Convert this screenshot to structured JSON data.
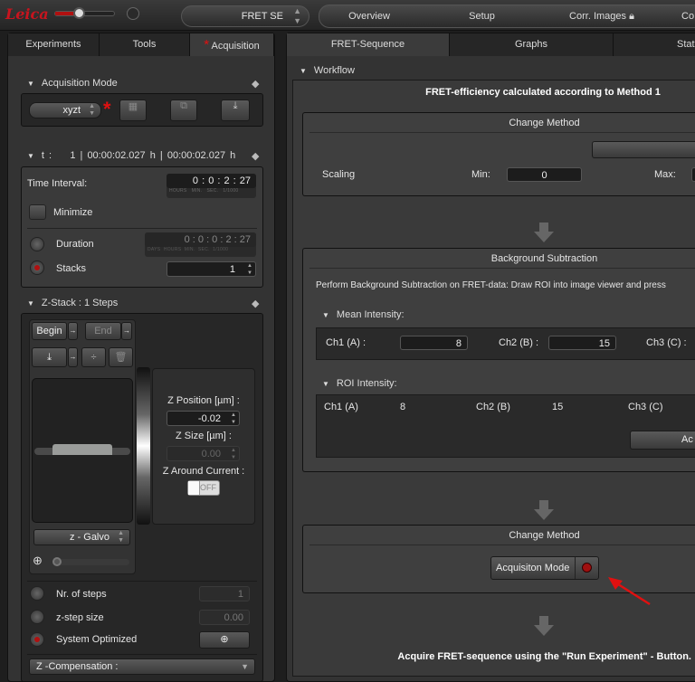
{
  "topbar": {
    "logo": "Leica",
    "mode": "FRET SE",
    "steps": [
      "Overview",
      "Setup",
      "Corr. Images",
      "Co"
    ]
  },
  "left": {
    "tabs": [
      "Experiments",
      "Tools",
      "Acquisition"
    ],
    "acq_mode": {
      "title": "Acquisition Mode",
      "value": "xyzt"
    },
    "time": {
      "header_t": "t :",
      "count": "1",
      "sep": "|",
      "total1": "00:00:02.027 h",
      "total2": "00:00:02.027 h",
      "interval_label": "Time Interval:",
      "interval": "0 : 0 : 2 : 27",
      "interval_units": "HOURS   MIN.   SEC.   1/1000",
      "minimize": "Minimize",
      "duration": "Duration",
      "duration_value": "0 : 0 : 0 : 2 : 27",
      "duration_units": "DAYS  HOURS  MIN.  SEC.  1/1000",
      "stacks": "Stacks",
      "stacks_value": "1"
    },
    "zstack": {
      "title": "Z-Stack :  1 Steps",
      "begin": "Begin",
      "end": "End",
      "z_position_label": "Z Position [µm] :",
      "z_position": "-0.02",
      "z_size_label": "Z Size [µm] :",
      "z_size": "0.00",
      "z_around_label": "Z Around Current :",
      "z_around": "OFF",
      "drive": "z - Galvo",
      "nr_steps": "Nr. of steps",
      "nr_steps_value": "1",
      "step_size": "z-step size",
      "step_size_value": "0.00",
      "system_optimized": "System Optimized",
      "z_comp": "Z -Compensation :"
    }
  },
  "right": {
    "tabs": [
      "FRET-Sequence",
      "Graphs",
      "Stati"
    ],
    "workflow": "Workflow",
    "title": "FRET-efficiency calculated according to Method 1",
    "change_method": {
      "title": "Change Method",
      "scaling": "Scaling",
      "min_label": "Min:",
      "min": "0",
      "max_label": "Max:"
    },
    "bg": {
      "title": "Background Subtraction",
      "desc": "Perform Background Subtraction on FRET-data: Draw ROI into image viewer and press",
      "mean_title": "Mean Intensity:",
      "ch1_label": "Ch1 (A) :",
      "ch1": "8",
      "ch2_label": "Ch2 (B) :",
      "ch2": "15",
      "ch3_label": "Ch3 (C) :",
      "roi_title": "ROI Intensity:",
      "roi_ch1_label": "Ch1 (A)",
      "roi_ch1": "8",
      "roi_ch2_label": "Ch2 (B)",
      "roi_ch2": "15",
      "roi_ch3_label": "Ch3 (C)",
      "accept": "Ac"
    },
    "change_method2": {
      "title": "Change Method",
      "button": "Acquisiton Mode"
    },
    "final": "Acquire FRET-sequence using the \"Run Experiment\" - Button."
  },
  "colors": {
    "accent_red": "#c8141e",
    "annotation_arrow": "#e01010"
  }
}
